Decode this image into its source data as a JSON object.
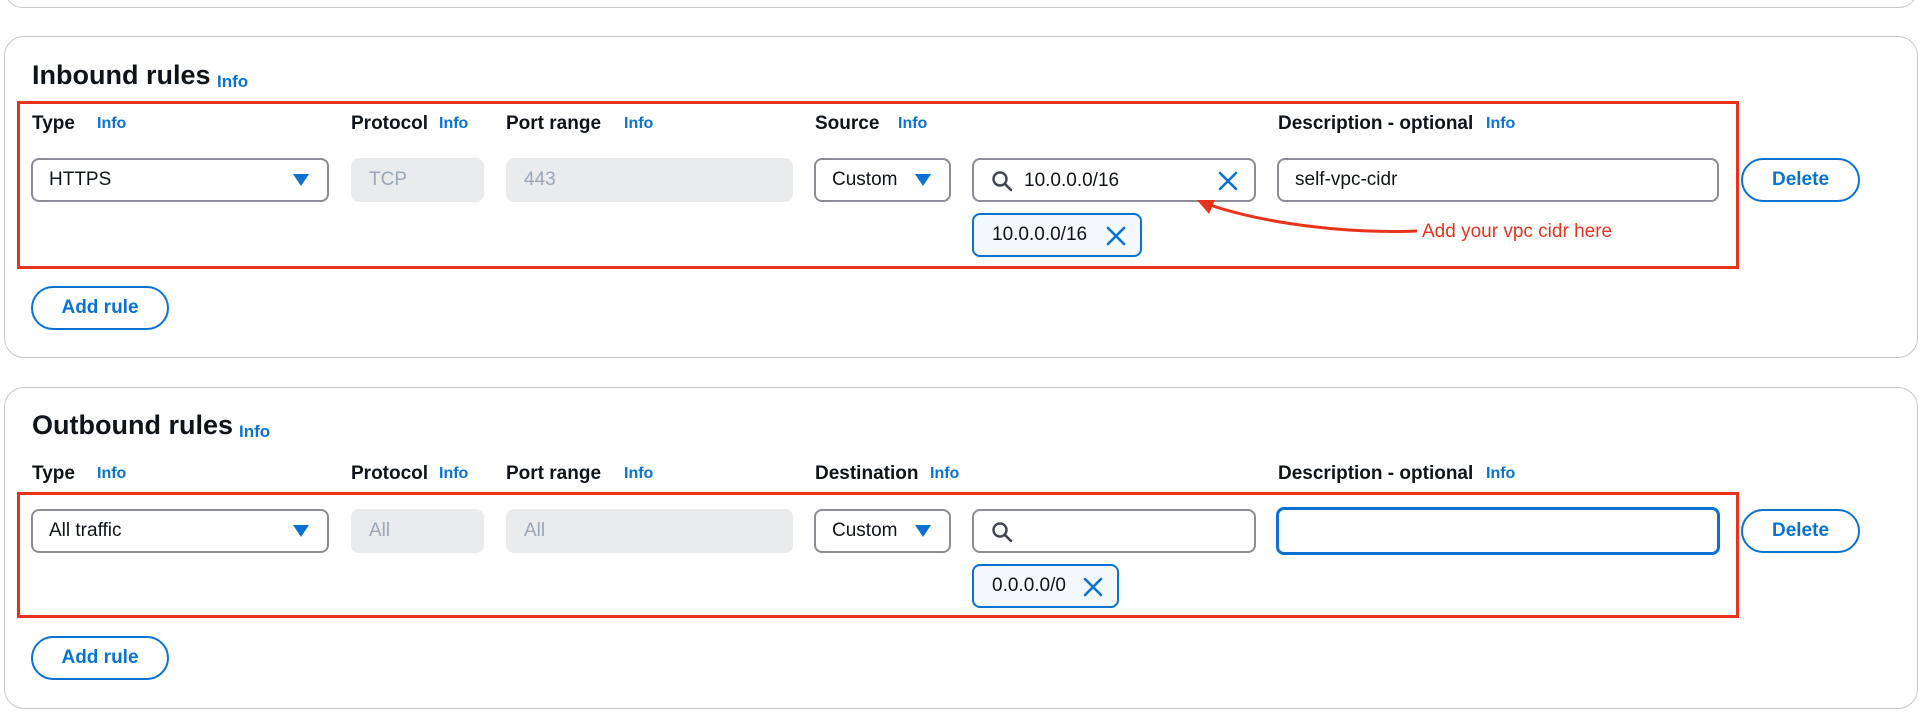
{
  "inbound": {
    "title": "Inbound rules",
    "info": "Info",
    "headers": {
      "type": "Type",
      "protocol": "Protocol",
      "port_range": "Port range",
      "source": "Source",
      "description": "Description - optional"
    },
    "rule": {
      "type": "HTTPS",
      "protocol": "TCP",
      "port_range": "443",
      "source_mode": "Custom",
      "source_search": "10.0.0.0/16",
      "source_token": "10.0.0.0/16",
      "description": "self-vpc-cidr"
    },
    "delete_label": "Delete",
    "add_rule_label": "Add rule",
    "annotation": "Add your vpc cidr here"
  },
  "outbound": {
    "title": "Outbound rules",
    "info": "Info",
    "headers": {
      "type": "Type",
      "protocol": "Protocol",
      "port_range": "Port range",
      "destination": "Destination",
      "description": "Description - optional"
    },
    "rule": {
      "type": "All traffic",
      "protocol": "All",
      "port_range": "All",
      "destination_mode": "Custom",
      "destination_search": "",
      "destination_token": "0.0.0.0/0",
      "description": ""
    },
    "delete_label": "Delete",
    "add_rule_label": "Add rule"
  },
  "icons": [
    "search-icon",
    "clear-icon",
    "dismiss-icon",
    "caret-down-icon"
  ],
  "colors": {
    "accent": "#0972d3",
    "annotation_red": "#e8331c",
    "disabled_bg": "#e9ebed",
    "token_bg": "#f2f8fd"
  }
}
